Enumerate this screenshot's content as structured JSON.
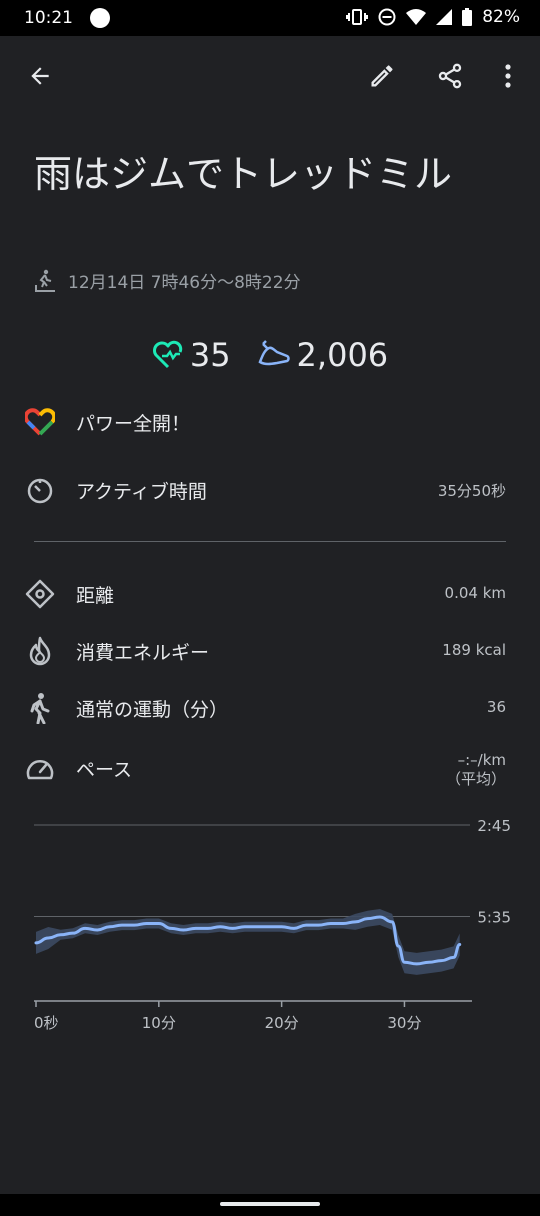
{
  "status_bar": {
    "time": "10:21",
    "battery": "82%"
  },
  "toolbar": {
    "back_icon": "arrow-back-icon",
    "edit_icon": "edit-pencil-icon",
    "share_icon": "share-icon",
    "more_icon": "more-vert-icon"
  },
  "activity": {
    "title": "雨はジムでトレッドミル",
    "datetime": "12月14日 7時46分～8時22分",
    "type_icon": "treadmill-icon"
  },
  "stats": {
    "heart_points": "35",
    "steps": "2,006"
  },
  "colors": {
    "accent_teal": "#1de9b6",
    "accent_blue": "#8ab4f8",
    "background": "#202124"
  },
  "goal": {
    "label": "パワー全開！",
    "icon": "google-fit-heart-icon"
  },
  "metrics": [
    {
      "icon": "timer-icon",
      "label": "アクティブ時間",
      "value": "35分50秒"
    },
    {
      "icon": "distance-icon",
      "label": "距離",
      "value": "0.04 km"
    },
    {
      "icon": "fire-icon",
      "label": "消費エネルギー",
      "value": "189 kcal"
    },
    {
      "icon": "walking-icon",
      "label": "通常の運動（分）",
      "value": "36"
    },
    {
      "icon": "speedometer-icon",
      "label": "ペース",
      "value": "–:–/km",
      "value2": "（平均）"
    }
  ],
  "chart_data": {
    "type": "line",
    "y_tick_labels": [
      "2:45",
      "5:35"
    ],
    "x_tick_labels": [
      "0秒",
      "10分",
      "20分",
      "30分"
    ],
    "x": [
      0,
      1,
      2,
      3,
      4,
      5,
      6,
      7,
      8,
      9,
      10,
      11,
      12,
      13,
      14,
      15,
      16,
      17,
      18,
      19,
      20,
      21,
      22,
      23,
      24,
      25,
      26,
      27,
      28,
      29,
      29.5,
      30,
      31,
      32,
      33,
      34,
      34.5
    ],
    "values": [
      6.4,
      6.25,
      6.15,
      6.1,
      5.95,
      6.0,
      5.9,
      5.85,
      5.85,
      5.8,
      5.8,
      5.95,
      6.0,
      5.95,
      5.95,
      5.9,
      5.95,
      5.9,
      5.9,
      5.9,
      5.9,
      5.95,
      5.85,
      5.85,
      5.8,
      5.8,
      5.75,
      5.65,
      5.6,
      5.75,
      6.5,
      7.0,
      7.05,
      7.0,
      6.95,
      6.85,
      6.45
    ],
    "xlim": [
      0,
      35.5
    ],
    "ylim": [
      2.75,
      8.2
    ],
    "y_reference_lines": [
      2.75,
      5.583
    ],
    "series_color": "#8ab4f8",
    "grid": true
  }
}
